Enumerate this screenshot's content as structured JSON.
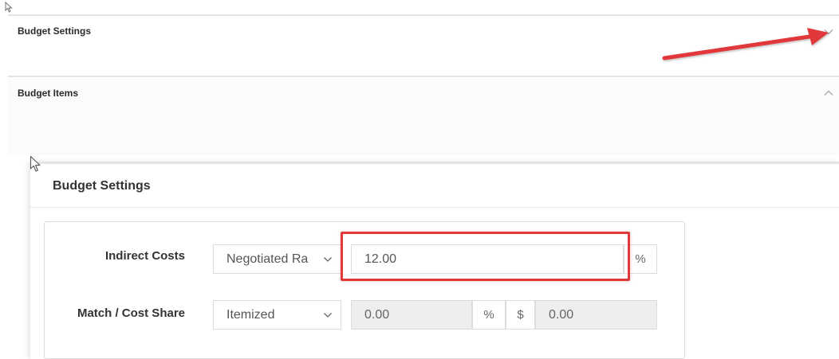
{
  "accordion": {
    "settings_title": "Budget Settings",
    "items_title": "Budget Items"
  },
  "zoom": {
    "title": "Budget Settings",
    "indirect": {
      "label": "Indirect Costs",
      "type_value": "Negotiated Ra",
      "rate_value": "12.00",
      "rate_unit": "%"
    },
    "match": {
      "label": "Match / Cost Share",
      "type_value": "Itemized",
      "percent_value": "0.00",
      "percent_unit": "%",
      "currency_symbol": "$",
      "amount_value": "0.00"
    }
  },
  "annotations": {
    "arrow_color": "#e0393a",
    "highlight_color": "#e0393a"
  },
  "icons": [
    "cursor-icon",
    "chevron-down-icon",
    "chevron-up-icon",
    "select-caret-icon"
  ]
}
